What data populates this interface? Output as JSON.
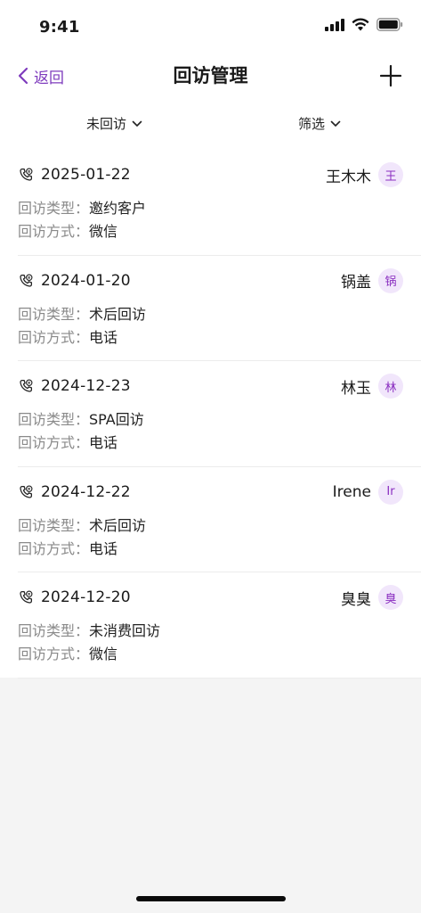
{
  "status_bar": {
    "time": "9:41"
  },
  "nav": {
    "back_label": "返回",
    "title": "回访管理"
  },
  "filters": {
    "status_label": "未回访",
    "screen_label": "筛选"
  },
  "labels": {
    "type": "回访类型：",
    "method": "回访方式："
  },
  "colors": {
    "accent": "#7e3bbd",
    "avatar_bg": "#f1e6fb",
    "avatar_text": "#8a2ec0",
    "page_bg": "#f4f4f4"
  },
  "items": [
    {
      "date": "2025-01-22",
      "name": "王木木",
      "avatar": "王",
      "type": "邀约客户",
      "method": "微信"
    },
    {
      "date": "2024-01-20",
      "name": "锅盖",
      "avatar": "锅",
      "type": "术后回访",
      "method": "电话"
    },
    {
      "date": "2024-12-23",
      "name": "林玉",
      "avatar": "林",
      "type": "SPA回访",
      "method": "电话"
    },
    {
      "date": "2024-12-22",
      "name": "Irene",
      "avatar": "Ir",
      "type": "术后回访",
      "method": "电话"
    },
    {
      "date": "2024-12-20",
      "name": "臭臭",
      "avatar": "臭",
      "type": "未消费回访",
      "method": "微信"
    }
  ]
}
